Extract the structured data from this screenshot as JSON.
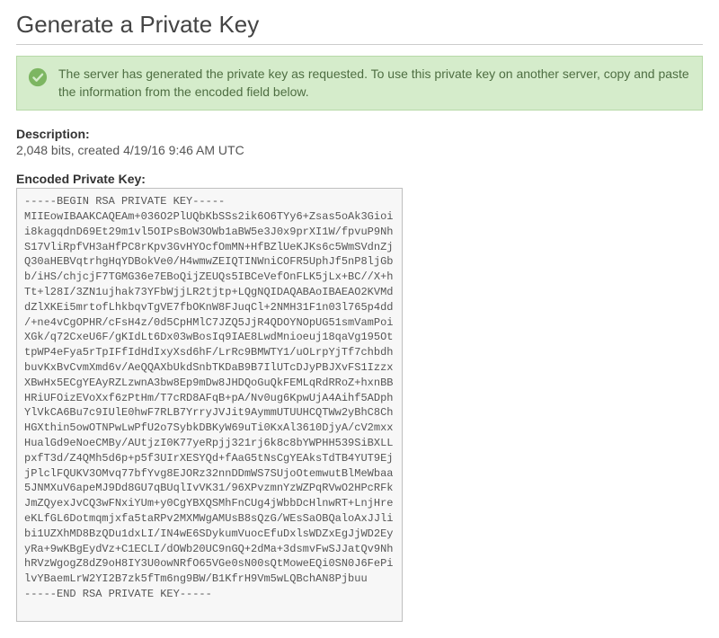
{
  "header": {
    "title": "Generate a Private Key"
  },
  "alert": {
    "message": "The server has generated the private key as requested. To use this private key on another server, copy and paste the information from the encoded field below."
  },
  "description": {
    "label": "Description:",
    "value": "2,048 bits, created 4/19/16 9:46 AM UTC"
  },
  "encoded": {
    "label": "Encoded Private Key:",
    "value": "-----BEGIN RSA PRIVATE KEY-----\nMIIEowIBAAKCAQEAm+036O2PlUQbKbSSs2ik6O6TYy6+Zsas5oAk3Gioi\ni8kagqdnD69Et29m1vl5OIPsBoW3OWb1aBW5e3J0x9prXI1W/fpvuP9Nh\nS17VliRpfVH3aHfPC8rKpv3GvHYOcfOmMN+HfBZlUeKJKs6c5WmSVdnZj\nQ30aHEBVqtrhgHqYDBokVe0/H4wmwZEIQTINWniCOFR5UphJf5nP8ljGb\nb/iHS/chjcjF7TGMG36e7EBoQijZEUQs5IBCeVefOnFLK5jLx+BC//X+h\nTt+l28I/3ZN1ujhak73YFbWjjLR2tjtp+LQgNQIDAQABAoIBAEAO2KVMd\ndZlXKEi5mrtofLhkbqvTgVE7fbOKnW8FJuqCl+2NMH31F1n03l765p4dd\n/+ne4vCgOPHR/cFsH4z/0d5CpHMlC7JZQ5JjR4QDOYNOpUG51smVamPoi\nXGk/q72CxeU6F/gKIdLt6Dx03wBosIq9IAE8LwdMnioeuj18qaVg195Ot\ntpWP4eFya5rTpIFfIdHdIxyXsd6hF/LrRc9BMWTY1/uOLrpYjTf7chbdh\nbuvKxBvCvmXmd6v/AeQQAXbUkdSnbTKDaB9B7IlUTcDJyPBJXvFS1Izzx\nXBwHx5ECgYEAyRZLzwnA3bw8Ep9mDw8JHDQoGuQkFEMLqRdRRoZ+hxnBB\nHRiUFOizEVoXxf6zPtHm/T7cRD8AFqB+pA/Nv0ug6KpwUjA4Aihf5ADph\nYlVkCA6Bu7c9IUlE0hwF7RLB7YrryJVJit9AymmUTUUHCQTWw2yBhC8Ch\nHGXthin5owOTNPwLwPfU2o7SybkDBKyW69uTi0KxAl3610DjyA/cV2mxx\nHualGd9eNoeCMBy/AUtjzI0K77yeRpjj321rj6k8c8bYWPHH539SiBXLL\npxfT3d/Z4QMh5d6p+p5f3UIrXESYQd+fAaG5tNsCgYEAksTdTB4YUT9Ej\njPlclFQUKV3OMvq77bfYvg8EJORz32nnDDmWS7SUjoOtemwutBlMeWbaa\n5JNMXuV6apeMJ9Dd8GU7qBUqlIvVK31/96XPvzmnYzWZPqRVwO2HPcRFk\nJmZQyexJvCQ3wFNxiYUm+y0CgYBXQSMhFnCUg4jWbbDcHlnwRT+LnjHre\neKLfGL6Dotmqmjxfa5taRPv2MXMWgAMUsB8sQzG/WEsSaOBQaloAxJJli\nbi1UZXhMD8BzQDu1dxLI/IN4wE6SDykumVuocEfuDxlsWDZxEgJjWD2Ey\nyRa+9wKBgEydVz+C1ECLI/dOWb20UC9nGQ+2dMa+3dsmvFwSJJatQv9Nh\nhRVzWgogZ8dZ9oH8IY3U0owNRfO65VGe0sN00sQtMoweEQi0SN0J6FePi\nlvYBaemLrW2YI2B7zk5fTm6ng9BW/B1KfrH9Vm5wLQBchAN8Pjbuu\n-----END RSA PRIVATE KEY-----"
  }
}
